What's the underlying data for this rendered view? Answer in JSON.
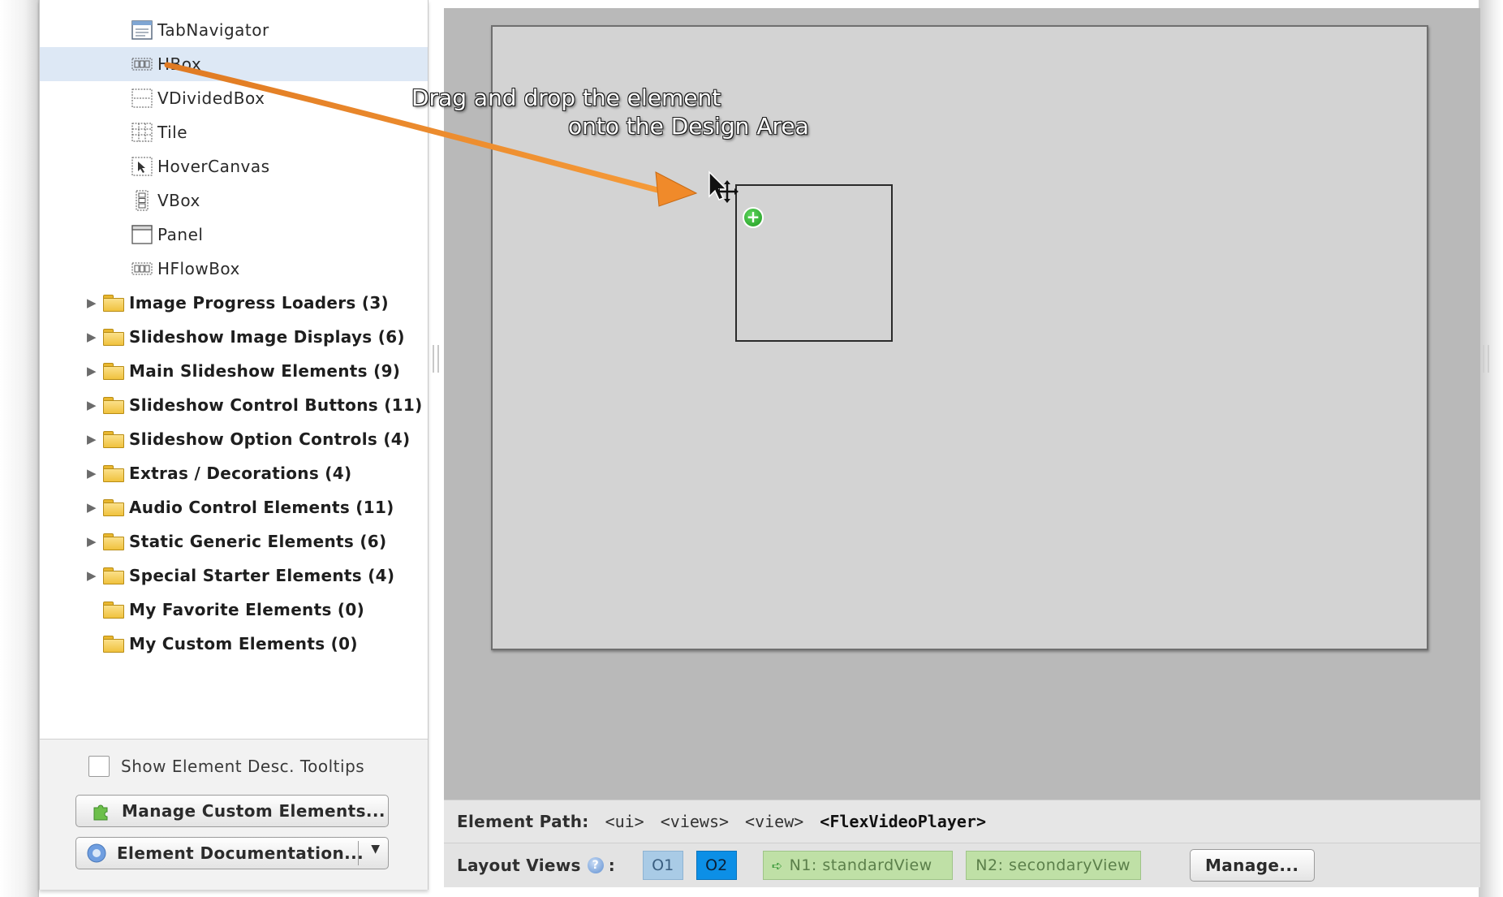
{
  "element_tree": {
    "components": [
      {
        "label": "TabNavigator",
        "icon": "tabnavigator-icon",
        "selected": false
      },
      {
        "label": "HBox",
        "icon": "hbox-icon",
        "selected": true
      },
      {
        "label": "VDividedBox",
        "icon": "vdividedbox-icon",
        "selected": false
      },
      {
        "label": "Tile",
        "icon": "tile-icon",
        "selected": false
      },
      {
        "label": "HoverCanvas",
        "icon": "hovercanvas-icon",
        "selected": false
      },
      {
        "label": "VBox",
        "icon": "vbox-icon",
        "selected": false
      },
      {
        "label": "Panel",
        "icon": "panel-icon",
        "selected": false
      },
      {
        "label": "HFlowBox",
        "icon": "hflowbox-icon",
        "selected": false
      }
    ],
    "folders": [
      {
        "label": "Image Progress Loaders (3)",
        "expandable": true
      },
      {
        "label": "Slideshow Image Displays (6)",
        "expandable": true
      },
      {
        "label": "Main Slideshow Elements (9)",
        "expandable": true
      },
      {
        "label": "Slideshow Control Buttons (11)",
        "expandable": true
      },
      {
        "label": "Slideshow Option Controls (4)",
        "expandable": true
      },
      {
        "label": "Extras / Decorations (4)",
        "expandable": true
      },
      {
        "label": "Audio Control Elements (11)",
        "expandable": true
      },
      {
        "label": "Static Generic Elements (6)",
        "expandable": true
      },
      {
        "label": "Special Starter Elements (4)",
        "expandable": true
      },
      {
        "label": "My Favorite Elements (0)",
        "expandable": false
      },
      {
        "label": "My Custom Elements (0)",
        "expandable": false
      }
    ]
  },
  "left_footer": {
    "tooltips_label": "Show Element Desc. Tooltips",
    "tooltips_checked": false,
    "manage_custom_label": "Manage Custom Elements...",
    "documentation_label": "Element Documentation..."
  },
  "design_area": {
    "callout_line1": "Drag and drop the element",
    "callout_line2": "onto the Design Area"
  },
  "element_path": {
    "label": "Element Path:",
    "tags": [
      "<ui>",
      "<views>",
      "<view>",
      "<FlexVideoPlayer>"
    ]
  },
  "layout_views": {
    "label": "Layout Views",
    "colon": ":",
    "o1": "O1",
    "o2": "O2",
    "n1": "N1: standardView",
    "n2": "N2: secondaryView",
    "manage_label": "Manage..."
  },
  "colors": {
    "selection": "#dde8f5",
    "workspace": "#b9b9b9",
    "canvas": "#d3d3d3",
    "callout_arrow": "#f08a2a",
    "o2_active": "#0c8fe6",
    "view_green": "#bfe0a6"
  }
}
